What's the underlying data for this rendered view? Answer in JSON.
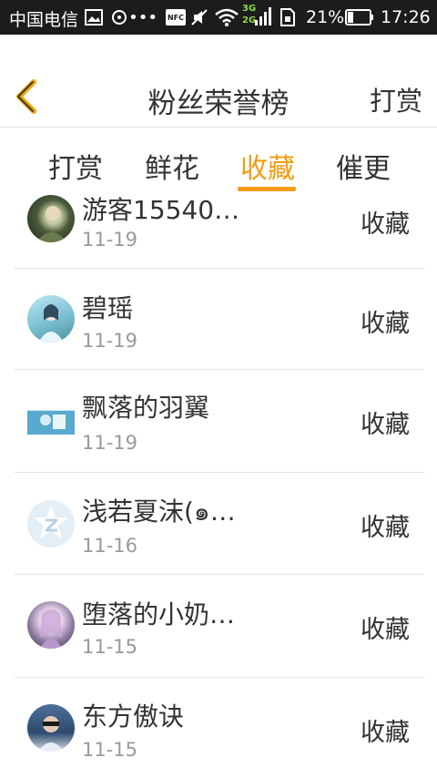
{
  "status_bar": {
    "carrier": "中国电信",
    "net_top": "3G",
    "net_bottom": "2G",
    "battery_percent": "21%",
    "time": "17:26",
    "nfc_label": "NFC",
    "icons": [
      "gallery-icon",
      "hotspot-icon",
      "more-dots-icon",
      "nfc-icon",
      "mute-icon",
      "wifi-icon",
      "signal-icon",
      "sim-icon",
      "battery-icon"
    ]
  },
  "header": {
    "title": "粉丝荣誉榜",
    "right_action": "打赏",
    "back_icon": "chevron-left-icon",
    "accent_color": "#f39c12"
  },
  "tabs": [
    {
      "label": "打赏",
      "active": false
    },
    {
      "label": "鲜花",
      "active": false
    },
    {
      "label": "收藏",
      "active": true
    },
    {
      "label": "催更",
      "active": false
    }
  ],
  "list": [
    {
      "name": "游客15540…",
      "date": "11-19",
      "action": "收藏"
    },
    {
      "name": "碧瑶",
      "date": "11-19",
      "action": "收藏"
    },
    {
      "name": "飘落的羽翼",
      "date": "11-19",
      "action": "收藏"
    },
    {
      "name": "浅若夏沫(๑…",
      "date": "11-16",
      "action": "收藏"
    },
    {
      "name": "堕落的小奶…",
      "date": "11-15",
      "action": "收藏"
    },
    {
      "name": "东方傲诀",
      "date": "11-15",
      "action": "收藏"
    }
  ]
}
